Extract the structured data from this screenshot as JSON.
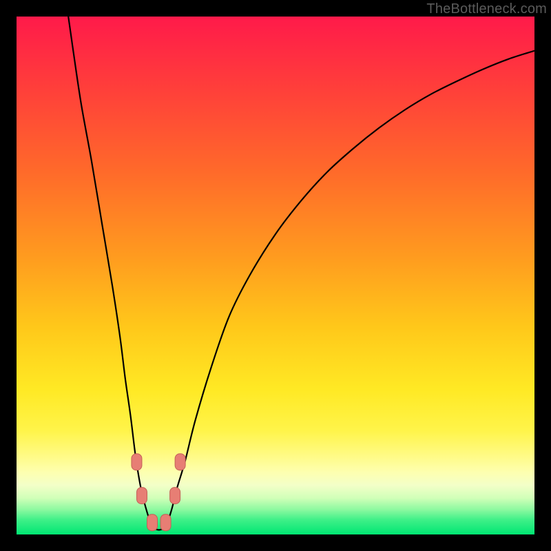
{
  "watermark": "TheBottleneck.com",
  "colors": {
    "black": "#000000",
    "curve": "#000000",
    "marker_fill": "#e77e74",
    "marker_stroke": "#c46057",
    "gradient_stops": [
      {
        "offset": 0.0,
        "color": "#ff1a4a"
      },
      {
        "offset": 0.14,
        "color": "#ff3f3a"
      },
      {
        "offset": 0.3,
        "color": "#ff6a2a"
      },
      {
        "offset": 0.46,
        "color": "#ff9a1f"
      },
      {
        "offset": 0.6,
        "color": "#ffc81a"
      },
      {
        "offset": 0.72,
        "color": "#ffe924"
      },
      {
        "offset": 0.8,
        "color": "#fff44a"
      },
      {
        "offset": 0.85,
        "color": "#fffb88"
      },
      {
        "offset": 0.88,
        "color": "#fdffb0"
      },
      {
        "offset": 0.905,
        "color": "#f3ffc8"
      },
      {
        "offset": 0.93,
        "color": "#d0ffb8"
      },
      {
        "offset": 0.952,
        "color": "#8cf9a0"
      },
      {
        "offset": 0.972,
        "color": "#3ef088"
      },
      {
        "offset": 1.0,
        "color": "#00e673"
      }
    ]
  },
  "chart_data": {
    "type": "line",
    "title": "",
    "xlabel": "",
    "ylabel": "",
    "xlim": [
      0,
      100
    ],
    "ylim": [
      0,
      100
    ],
    "x": [
      10,
      11,
      12.5,
      14.5,
      16.5,
      18.5,
      20,
      21,
      22,
      23,
      24,
      25,
      26,
      27,
      28,
      29,
      30,
      31,
      32.5,
      34.5,
      37.5,
      41,
      45,
      50,
      55,
      60,
      65,
      70,
      75,
      80,
      85,
      90,
      95,
      100
    ],
    "y": [
      100,
      93,
      83,
      72,
      60,
      48,
      38,
      30,
      23,
      15,
      9,
      5,
      2,
      1,
      1,
      2,
      5,
      9,
      14,
      22,
      32,
      42,
      50,
      58,
      64.5,
      70,
      74.5,
      78.5,
      82,
      85,
      87.5,
      89.8,
      91.8,
      93.4
    ],
    "markers": [
      {
        "x": 23.2,
        "y": 14.0
      },
      {
        "x": 24.2,
        "y": 7.5
      },
      {
        "x": 26.2,
        "y": 2.3
      },
      {
        "x": 28.8,
        "y": 2.3
      },
      {
        "x": 30.6,
        "y": 7.5
      },
      {
        "x": 31.6,
        "y": 14.0
      }
    ],
    "notch_x": 27.5,
    "gradient_vertical_red_to_green": true
  }
}
